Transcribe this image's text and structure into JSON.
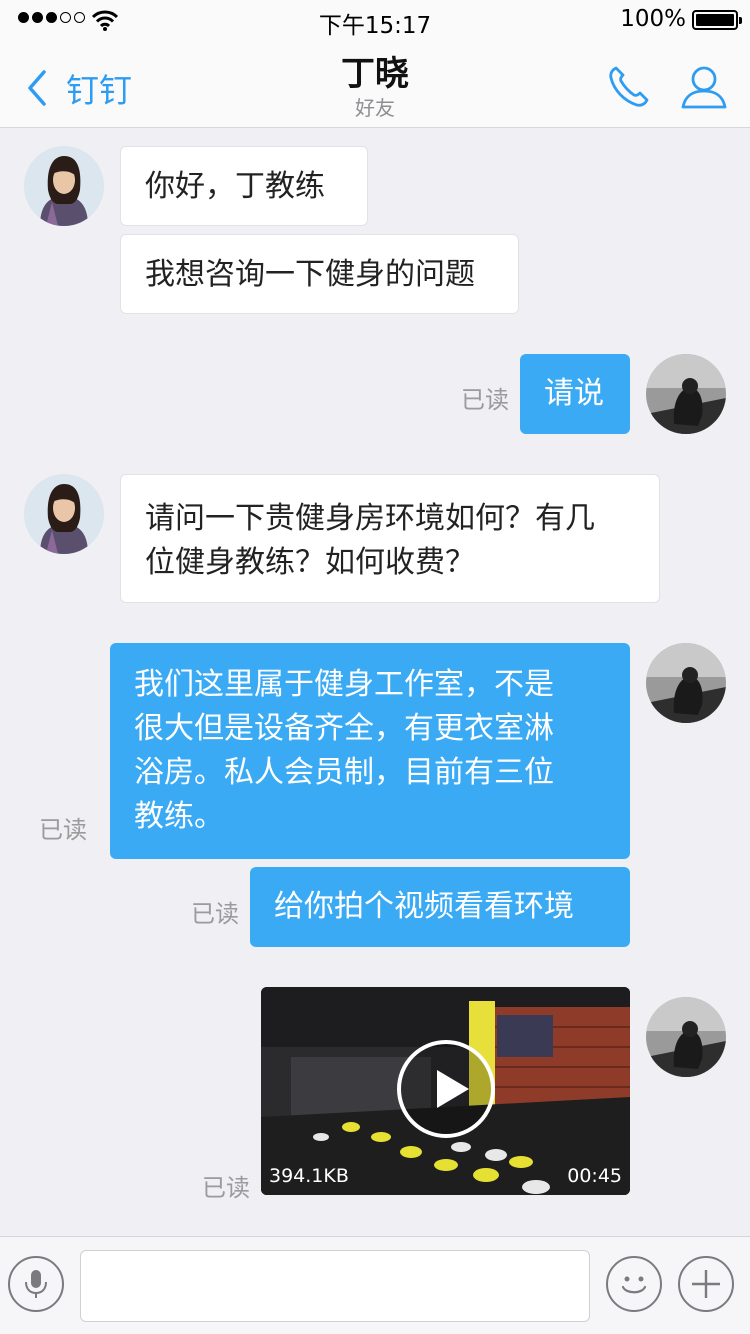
{
  "status_bar": {
    "time": "下午15:17",
    "battery": "100%"
  },
  "nav": {
    "back_label": "钉钉",
    "title": "丁晓",
    "subtitle": "好友"
  },
  "messages": [
    {
      "from": "contact",
      "text": "你好，丁教练"
    },
    {
      "from": "contact",
      "text": "我想咨询一下健身的问题"
    },
    {
      "from": "me",
      "text": "请说",
      "read": "已读"
    },
    {
      "from": "contact",
      "lines": [
        "请问一下贵健身房环境如何？有几",
        "位健身教练？如何收费？"
      ]
    },
    {
      "from": "me",
      "lines": [
        "我们这里属于健身工作室，不是",
        "很大但是设备齐全，有更衣室淋",
        "浴房。私人会员制，目前有三位",
        "教练。"
      ],
      "read": "已读"
    },
    {
      "from": "me",
      "text": "给你拍个视频看看环境",
      "read": "已读"
    },
    {
      "from": "me",
      "type": "video",
      "size": "394.1KB",
      "duration": "00:45",
      "read": "已读"
    }
  ],
  "colors": {
    "accent": "#2e9cf0",
    "outgoing_bubble": "#3aaaf5",
    "background": "#efeff4"
  },
  "icons": [
    "phone-icon",
    "contact-icon",
    "back-chevron-icon",
    "microphone-icon",
    "emoji-icon",
    "plus-icon",
    "play-icon"
  ]
}
